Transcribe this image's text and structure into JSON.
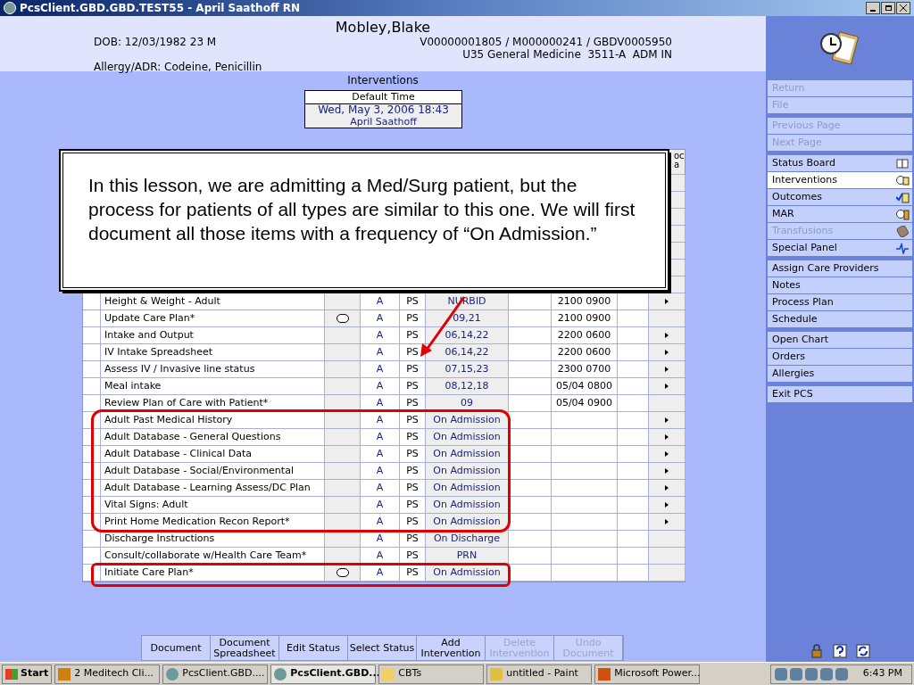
{
  "window": {
    "title": "PcsClient.GBD.GBD.TEST55 - April Saathoff RN"
  },
  "patient": {
    "name": "Mobley,Blake",
    "dob": "DOB: 12/03/1982 23 M",
    "allergy": "Allergy/ADR: Codeine, Penicillin",
    "account": "V00000001805 / M000000241 / GBDV0005950",
    "location": "U35 General Medicine  3511-A  ADM IN"
  },
  "page_title": "Interventions",
  "default_time": {
    "label": "Default Time",
    "value": "Wed, May 3, 2006  18:43",
    "user": "April Saathoff"
  },
  "table": {
    "header_fragment": [
      "oc",
      "a"
    ],
    "rows": [
      {
        "name": "Height & Weight - Adult",
        "comment": false,
        "status": "A",
        "source": "PS",
        "frequency": "NURBID",
        "due": "2100 0900",
        "has_submenu": true
      },
      {
        "name": "Update Care Plan*",
        "comment": true,
        "status": "A",
        "source": "PS",
        "frequency": "09,21",
        "due": "2100 0900",
        "has_submenu": false
      },
      {
        "name": "Intake and Output",
        "comment": false,
        "status": "A",
        "source": "PS",
        "frequency": "06,14,22",
        "due": "2200 0600",
        "has_submenu": true
      },
      {
        "name": "IV Intake Spreadsheet",
        "comment": false,
        "status": "A",
        "source": "PS",
        "frequency": "06,14,22",
        "due": "2200 0600",
        "has_submenu": true
      },
      {
        "name": "Assess IV / Invasive line status",
        "comment": false,
        "status": "A",
        "source": "PS",
        "frequency": "07,15,23",
        "due": "2300 0700",
        "has_submenu": true
      },
      {
        "name": "Meal intake",
        "comment": false,
        "status": "A",
        "source": "PS",
        "frequency": "08,12,18",
        "due": "05/04 0800",
        "has_submenu": true
      },
      {
        "name": "Review Plan of Care with Patient*",
        "comment": false,
        "status": "A",
        "source": "PS",
        "frequency": "09",
        "due": "05/04 0900",
        "has_submenu": false
      },
      {
        "name": "Adult Past Medical History",
        "comment": false,
        "status": "A",
        "source": "PS",
        "frequency": "On Admission",
        "due": "",
        "has_submenu": true
      },
      {
        "name": "Adult Database - General Questions",
        "comment": false,
        "status": "A",
        "source": "PS",
        "frequency": "On Admission",
        "has_submenu": true
      },
      {
        "name": "Adult Database - Clinical Data",
        "comment": false,
        "status": "A",
        "source": "PS",
        "frequency": "On Admission",
        "has_submenu": true
      },
      {
        "name": "Adult Database - Social/Environmental",
        "comment": false,
        "status": "A",
        "source": "PS",
        "frequency": "On Admission",
        "has_submenu": true
      },
      {
        "name": "Adult Database - Learning Assess/DC Plan",
        "comment": false,
        "status": "A",
        "source": "PS",
        "frequency": "On Admission",
        "has_submenu": true
      },
      {
        "name": "Vital Signs: Adult",
        "comment": false,
        "status": "A",
        "source": "PS",
        "frequency": "On Admission",
        "has_submenu": true
      },
      {
        "name": "Print Home Medication Recon Report*",
        "comment": false,
        "status": "A",
        "source": "PS",
        "frequency": "On Admission",
        "has_submenu": true
      },
      {
        "name": "Discharge Instructions",
        "comment": false,
        "status": "A",
        "source": "PS",
        "frequency": "On Discharge",
        "has_submenu": false
      },
      {
        "name": "Consult/collaborate w/Health Care Team*",
        "comment": false,
        "status": "A",
        "source": "PS",
        "frequency": "PRN",
        "has_submenu": false
      },
      {
        "name": "Initiate Care Plan*",
        "comment": true,
        "status": "A",
        "source": "PS",
        "frequency": "On Admission",
        "has_submenu": false
      }
    ]
  },
  "callout": {
    "text": "In this lesson, we are admitting a Med/Surg patient, but the process for patients of all types are similar to this one. We will first document all those items with a frequency of “On Admission.”"
  },
  "sidebar": {
    "groups": [
      [
        {
          "label": "Return",
          "disabled": true
        },
        {
          "label": "File",
          "disabled": true
        }
      ],
      [
        {
          "label": "Previous Page",
          "disabled": true
        },
        {
          "label": "Next Page",
          "disabled": true
        }
      ],
      [
        {
          "label": "Status Board",
          "disabled": false,
          "selected": false
        },
        {
          "label": "Interventions",
          "disabled": false,
          "selected": true
        },
        {
          "label": "Outcomes",
          "disabled": false,
          "selected": false
        },
        {
          "label": "MAR",
          "disabled": false,
          "selected": false
        },
        {
          "label": "Transfusions",
          "disabled": true,
          "selected": false
        },
        {
          "label": "Special Panel",
          "disabled": false,
          "selected": false
        }
      ],
      [
        {
          "label": "Assign Care Providers",
          "disabled": false
        },
        {
          "label": "Notes",
          "disabled": false
        },
        {
          "label": "Process Plan",
          "disabled": false
        },
        {
          "label": "Schedule",
          "disabled": false
        }
      ],
      [
        {
          "label": "Open Chart",
          "disabled": false
        },
        {
          "label": "Orders",
          "disabled": false
        },
        {
          "label": "Allergies",
          "disabled": false
        }
      ],
      [
        {
          "label": "Exit PCS",
          "disabled": false
        }
      ]
    ]
  },
  "actions": [
    {
      "label": "Document",
      "disabled": false
    },
    {
      "label": "Document Spreadsheet",
      "disabled": false
    },
    {
      "label": "Edit Status",
      "disabled": false
    },
    {
      "label": "Select Status",
      "disabled": false
    },
    {
      "label": "Add Intervention",
      "disabled": false
    },
    {
      "label": "Delete Intervention",
      "disabled": true
    },
    {
      "label": "Undo Document",
      "disabled": true
    }
  ],
  "taskbar": {
    "start": "Start",
    "tasks": [
      {
        "label": "2 Meditech Cli...",
        "selected": false
      },
      {
        "label": "PcsClient.GBD....",
        "selected": false
      },
      {
        "label": "PcsClient.GBD...",
        "selected": true
      },
      {
        "label": "CBTs",
        "selected": false
      },
      {
        "label": "untitled - Paint",
        "selected": false
      },
      {
        "label": "Microsoft Power...",
        "selected": false
      }
    ],
    "clock": "6:43 PM"
  }
}
